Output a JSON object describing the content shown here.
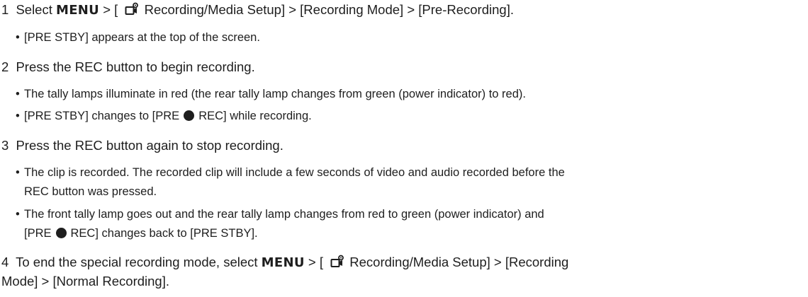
{
  "steps": [
    {
      "num": "1",
      "pre": "Select",
      "menu": "MENU",
      "seg1": "> [",
      "icon": "recording-media-setup-icon",
      "seg2": "Recording/Media Setup] > [Recording Mode] > [Pre-Recording].",
      "bullets": [
        "[PRE STBY] appears at the top of the screen."
      ]
    },
    {
      "num": "2",
      "text": "Press the REC button to begin recording.",
      "bullets": [
        "The tally lamps illuminate in red (the rear tally lamp changes from green (power indicator) to red).",
        {
          "before": "[PRE STBY] changes to [PRE",
          "after": "REC] while recording."
        }
      ]
    },
    {
      "num": "3",
      "text": "Press the REC button again to stop recording.",
      "bullets": [
        {
          "line1": "The clip is recorded. The recorded clip will include a few seconds of video and audio recorded before the",
          "line2": "REC button was pressed."
        },
        {
          "line1": "The front tally lamp goes out and the rear tally lamp changes from red to green (power indicator) and",
          "line2_before": "[PRE",
          "line2_after": "REC] changes back to [PRE STBY]."
        }
      ]
    },
    {
      "num": "4",
      "pre": "To end the special recording mode, select",
      "menu": "MENU",
      "seg1": "> [",
      "icon": "recording-media-setup-icon",
      "seg2": "Recording/Media Setup] > [Recording",
      "line2": "Mode] > [Normal Recording]."
    }
  ],
  "bullet_char": "•"
}
